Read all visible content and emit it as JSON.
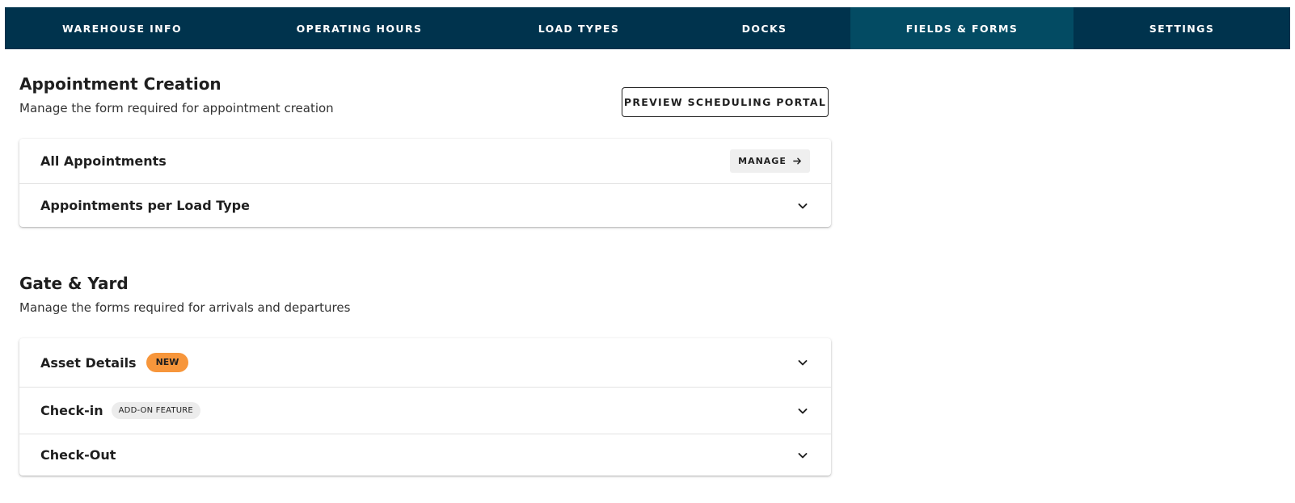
{
  "tabs": [
    {
      "label": "WAREHOUSE INFO",
      "active": false
    },
    {
      "label": "OPERATING HOURS",
      "active": false
    },
    {
      "label": "LOAD TYPES",
      "active": false
    },
    {
      "label": "DOCKS",
      "active": false
    },
    {
      "label": "FIELDS & FORMS",
      "active": true
    },
    {
      "label": "SETTINGS",
      "active": false
    }
  ],
  "appointment_creation": {
    "title": "Appointment Creation",
    "subtitle": "Manage the form required for appointment creation",
    "preview_button": "PREVIEW SCHEDULING PORTAL",
    "rows": [
      {
        "label": "All Appointments",
        "action": "MANAGE",
        "action_icon": "arrow-right-icon"
      },
      {
        "label": "Appointments per Load Type",
        "icon": "chevron-down-icon"
      }
    ]
  },
  "gate_yard": {
    "title": "Gate & Yard",
    "subtitle": "Manage the forms required for arrivals and departures",
    "rows": [
      {
        "label": "Asset Details",
        "badge": "NEW",
        "icon": "chevron-down-icon"
      },
      {
        "label": "Check-in",
        "badge": "ADD-ON FEATURE",
        "icon": "chevron-down-icon"
      },
      {
        "label": "Check-Out",
        "icon": "chevron-down-icon"
      }
    ]
  },
  "colors": {
    "tab_bar": "#00334d",
    "tab_active": "#034b63",
    "badge_new": "#f7963b",
    "badge_addon": "#ececec"
  }
}
